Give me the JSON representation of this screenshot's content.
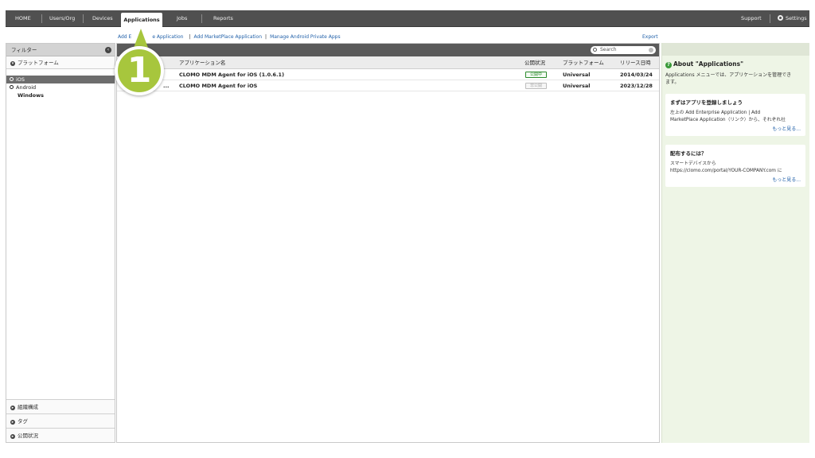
{
  "nav": {
    "home": "HOME",
    "users_org": "Users/Org",
    "devices": "Devices",
    "applications": "Applications",
    "jobs": "Jobs",
    "reports": "Reports",
    "support": "Support",
    "settings": "Settings"
  },
  "sublinks": {
    "add_enterprise_prefix": "Add E",
    "add_enterprise_suffix": "e Application",
    "add_marketplace": "Add MarketPlace Application",
    "manage_android": "Manage Android Private Apps",
    "separator": "|",
    "export": "Export"
  },
  "filter": {
    "title": "フィルター",
    "collapse_glyph": "‹",
    "platform_section": "プラットフォーム",
    "platforms": [
      {
        "label": "iOS",
        "selected": true
      },
      {
        "label": "Android",
        "selected": false
      },
      {
        "label": "Windows",
        "selected": false
      }
    ],
    "bottom_sections": [
      "組織構成",
      "タグ",
      "公開状況"
    ]
  },
  "search": {
    "placeholder": "Search"
  },
  "table": {
    "columns": {
      "name": "アプリケーション名",
      "status": "公開状況",
      "platform": "プラットフォーム",
      "release": "リリース日時"
    },
    "rows": [
      {
        "prefix": "",
        "name": "CLOMO MDM Agent for iOS (1.0.6.1)",
        "status": "公開中",
        "status_type": "published",
        "platform": "Universal",
        "release": "2014/03/24"
      },
      {
        "prefix": "...",
        "name": "CLOMO MDM Agent for iOS",
        "status": "非公開",
        "status_type": "unpublished",
        "platform": "Universal",
        "release": "2023/12/28"
      }
    ]
  },
  "help": {
    "title": "About \"Applications\"",
    "intro_line1": "Applications メニューでは、アプリケーションを管理でき",
    "intro_line2": "ます。",
    "cards": [
      {
        "title": "まずはアプリを登録しましょう",
        "line1": "左上の Add Enterprise Application | Add",
        "line2": "MarketPlace Application（リンク）から、それぞれ社",
        "more": "もっと見る..."
      },
      {
        "title": "配布するには？",
        "line1": "スマートデバイスから",
        "line2": "https://clomo.com/portal/YOUR-COMPANY.com に",
        "more": "もっと見る..."
      }
    ]
  },
  "callout": {
    "number": "1"
  },
  "colors": {
    "nav_bg": "#505050",
    "link": "#1f5fa8",
    "callout": "#a7c63d",
    "published": "#2b8a2b",
    "help_bg": "#eef5e6"
  }
}
